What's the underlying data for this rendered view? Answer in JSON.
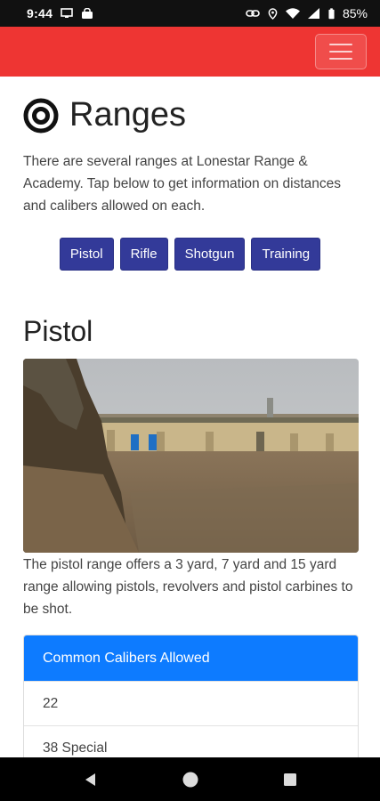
{
  "status_bar": {
    "time": "9:44",
    "battery": "85%"
  },
  "icons": {
    "menu": "hamburger-menu-icon",
    "title": "target-bullseye-icon",
    "nav_back": "back-triangle-icon",
    "nav_home": "home-circle-icon",
    "nav_recents": "recents-square-icon"
  },
  "colors": {
    "navbar": "#ee3533",
    "range_buttons": "#333a99",
    "card_header": "#0d7bff"
  },
  "page": {
    "title": "Ranges",
    "intro": "There are several ranges at Lonestar Range & Academy. Tap below to get information on distances and calibers allowed on each."
  },
  "range_buttons": [
    "Pistol",
    "Rifle",
    "Shotgun",
    "Training"
  ],
  "pistol_section": {
    "title": "Pistol",
    "description": "The pistol range offers a 3 yard, 7 yard and 15 yard range allowing pistols, revolvers and pistol carbines to be shot.",
    "calibers": {
      "header": "Common Calibers Allowed",
      "items": [
        "22",
        "38 Special"
      ]
    }
  }
}
